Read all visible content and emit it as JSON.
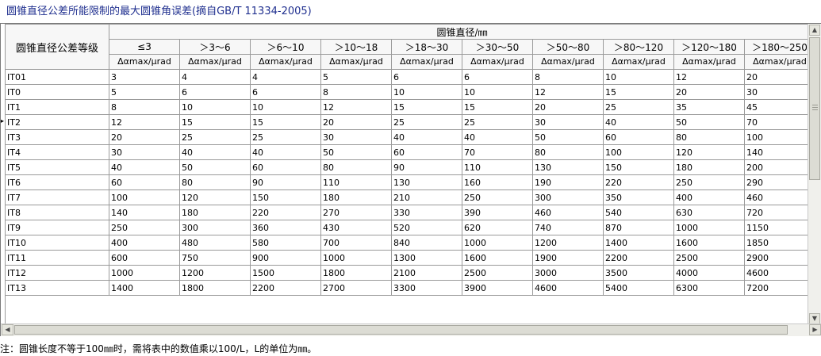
{
  "title": "圆锥直径公差所能限制的最大圆锥角误差(摘自GB/T 11334-2005)",
  "table": {
    "grade_header": "圆锥直径公差等级",
    "group_header": "圆锥直径/㎜",
    "ranges": [
      "≤3",
      "＞3～6",
      "＞6～10",
      "＞10～18",
      "＞18～30",
      "＞30～50",
      "＞50～80",
      "＞80～120",
      "＞120～180",
      "＞180～250"
    ],
    "unit_label": "Δαmax/μrad",
    "rows": [
      {
        "grade": "IT01",
        "values": [
          "3",
          "4",
          "4",
          "5",
          "6",
          "6",
          "8",
          "10",
          "12",
          "20"
        ]
      },
      {
        "grade": "IT0",
        "values": [
          "5",
          "6",
          "6",
          "8",
          "10",
          "10",
          "12",
          "15",
          "20",
          "30"
        ]
      },
      {
        "grade": "IT1",
        "values": [
          "8",
          "10",
          "10",
          "12",
          "15",
          "15",
          "20",
          "25",
          "35",
          "45"
        ]
      },
      {
        "grade": "IT2",
        "values": [
          "12",
          "15",
          "15",
          "20",
          "25",
          "25",
          "30",
          "40",
          "50",
          "70"
        ]
      },
      {
        "grade": "IT3",
        "values": [
          "20",
          "25",
          "25",
          "30",
          "40",
          "40",
          "50",
          "60",
          "80",
          "100"
        ]
      },
      {
        "grade": "IT4",
        "values": [
          "30",
          "40",
          "40",
          "50",
          "60",
          "70",
          "80",
          "100",
          "120",
          "140"
        ]
      },
      {
        "grade": "IT5",
        "values": [
          "40",
          "50",
          "60",
          "80",
          "90",
          "110",
          "130",
          "150",
          "180",
          "200"
        ]
      },
      {
        "grade": "IT6",
        "values": [
          "60",
          "80",
          "90",
          "110",
          "130",
          "160",
          "190",
          "220",
          "250",
          "290"
        ]
      },
      {
        "grade": "IT7",
        "values": [
          "100",
          "120",
          "150",
          "180",
          "210",
          "250",
          "300",
          "350",
          "400",
          "460"
        ]
      },
      {
        "grade": "IT8",
        "values": [
          "140",
          "180",
          "220",
          "270",
          "330",
          "390",
          "460",
          "540",
          "630",
          "720"
        ]
      },
      {
        "grade": "IT9",
        "values": [
          "250",
          "300",
          "360",
          "430",
          "520",
          "620",
          "740",
          "870",
          "1000",
          "1150"
        ]
      },
      {
        "grade": "IT10",
        "values": [
          "400",
          "480",
          "580",
          "700",
          "840",
          "1000",
          "1200",
          "1400",
          "1600",
          "1850"
        ]
      },
      {
        "grade": "IT11",
        "values": [
          "600",
          "750",
          "900",
          "1000",
          "1300",
          "1600",
          "1900",
          "2200",
          "2500",
          "2900"
        ]
      },
      {
        "grade": "IT12",
        "values": [
          "1000",
          "1200",
          "1500",
          "1800",
          "2100",
          "2500",
          "3000",
          "3500",
          "4000",
          "4600"
        ]
      },
      {
        "grade": "IT13",
        "values": [
          "1400",
          "1800",
          "2200",
          "2700",
          "3300",
          "3900",
          "4600",
          "5400",
          "6300",
          "7200"
        ]
      }
    ]
  },
  "note": "注：圆锥长度不等于100㎜时，需将表中的数值乘以100/L，L的单位为㎜。",
  "colors": {
    "title": "#1f2f8f",
    "grid_line": "#9a9a9a",
    "header_bg": "#f7f7f7"
  },
  "icons": {
    "scroll_up": "arrow-up-icon",
    "scroll_down": "arrow-down-icon",
    "scroll_left": "arrow-left-icon",
    "scroll_right": "arrow-right-icon"
  }
}
